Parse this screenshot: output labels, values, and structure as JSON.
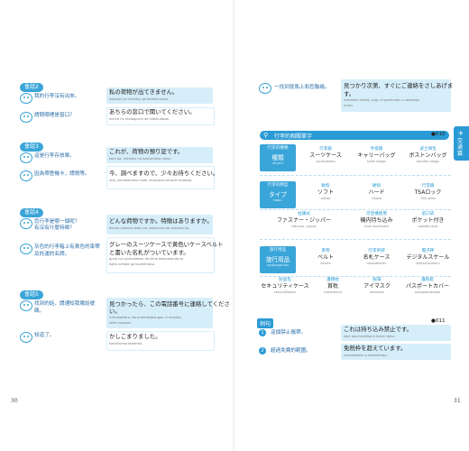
{
  "left": {
    "page_number": "30",
    "dialog2": {
      "label": "會話2",
      "q1": "我的行李沒有出來。",
      "q2": "請問哪裡是窗口？",
      "a1_jp": "私の荷物が出てきません。",
      "a1_rom": "watashi no nimotsu ga detekimasen.",
      "a2_jp": "あちらの窓口で聞いてください。",
      "a2_rom": "achira no madoguchi de kiitekudasai."
    },
    "dialog3": {
      "label": "會話3",
      "q1": "這是行李存放單。",
      "q2": "因為帶登機卡，請稍等。",
      "a1_jp": "これが、荷物の預り証です。",
      "a1_rom": "kore ga, nimotsu no azukarishou desu.",
      "a2_jp": "今、調べますので、少々お待ちください。",
      "a2_rom": "ima, shirabemasu node, shoushou omachi kudasai."
    },
    "dialog4": {
      "label": "會話4",
      "q1": "您行李是哪一個呢？",
      "q1b": "有沒有什麼特徵？",
      "q2": "灰色的行李箱上有黃色的束帶",
      "q2b": "及託運的名牌。",
      "a1_jp": "どんな荷物ですか。特徴はありますか。",
      "a1_rom": "donna nimotsu desu ka. tokuchou wa arimasu ka.",
      "a2_jp": "グレーのスーツケースで黄色いケースベルト",
      "a2_jp2": "と書いた名札がついています。",
      "a2_rom": "gurei no suutsukeesu de kiiroi keesuberuto to",
      "a2_rom2": "kaita nafuda ga tsuiteimasu."
    },
    "dialog5": {
      "label": "會話5",
      "q1": "找到的話，請通知我電話號",
      "q1b": "碼。",
      "q2": "知道了。",
      "a1_jp": "見つかったら、この電話番号に連絡してくださ",
      "a1_jp2": "い。",
      "a1_rom": "mitsukattara, kono denwabangou ni renraku",
      "a1_rom2": "shite kudasai.",
      "a2_jp": "かしこまりました。",
      "a2_rom": "kashikomarimashita."
    }
  },
  "right": {
    "page_number": "31",
    "top": {
      "q": "一找到就馬上和您聯絡。",
      "a_jp": "見つかり次第、すぐにご連絡をさしあげま",
      "a_jp2": "す。",
      "a_rom": "mitsukari shidai, sugu ni gorenraku o sashiage",
      "a_rom2": "masu."
    },
    "vocab_title": "行李的相關單字",
    "track1": "010",
    "row1": {
      "cat_zh": "行李的種類",
      "cat_jp": "種類",
      "cat_rom": "shurui",
      "items": [
        {
          "zh": "行李箱",
          "jp": "スーツケース",
          "rom": "suutsukeesu"
        },
        {
          "zh": "手提箱",
          "jp": "キャリーバッグ",
          "rom": "kyarii baggu"
        },
        {
          "zh": "波士頓包",
          "jp": "ボストンバッグ",
          "rom": "bosuton baggu"
        }
      ]
    },
    "row2": {
      "cat_zh": "行李的類型",
      "cat_jp": "タイプ",
      "cat_rom": "taipu",
      "items": [
        {
          "zh": "軟殼",
          "jp": "ソフト",
          "rom": "sofuto"
        },
        {
          "zh": "硬殼",
          "jp": "ハード",
          "rom": "haado"
        },
        {
          "zh": "行李鎖",
          "jp": "TSAロック",
          "rom": "TSA rokku"
        },
        {
          "zh": "拉鍊式",
          "jp": "ファスナー・ジッパー",
          "rom": "fasunaa・jippaa"
        },
        {
          "zh": "可登機使用",
          "jp": "機内持ち込み",
          "rom": "kinai mochikomi"
        },
        {
          "zh": "前口袋",
          "jp": "ポケット付き",
          "rom": "poketto tsuki"
        }
      ]
    },
    "row3": {
      "cat_zh": "旅行用品",
      "cat_jp": "旅行用品",
      "cat_rom": "ryokouyouhin",
      "items": [
        {
          "zh": "束帶",
          "jp": "ベルト",
          "rom": "beruto"
        },
        {
          "zh": "行李吊牌",
          "jp": "名札ケース",
          "rom": "nafudakeesu"
        },
        {
          "zh": "電子秤",
          "jp": "デジタルスケール",
          "rom": "dejitarusukeeru"
        },
        {
          "zh": "防盜包",
          "jp": "セキュリティケース",
          "rom": "sekyuritikeesu"
        },
        {
          "zh": "護頸枕",
          "jp": "首枕",
          "rom": "kubimakura"
        },
        {
          "zh": "眼罩",
          "jp": "アイマスク",
          "rom": "aimasuku"
        },
        {
          "zh": "護照套",
          "jp": "パスポートカバー",
          "rom": "pasupootokabaa"
        }
      ]
    },
    "example_label": "例句",
    "track2": "011",
    "examples": [
      {
        "num": "1",
        "zh": "這個禁止攜帶。",
        "jp": "これは持ち込み禁止です。",
        "rom": "kore wa mochikomi kinshi desu."
      },
      {
        "num": "2",
        "zh": "超過免費的範圍。",
        "jp": "免税枠を超えています。",
        "rom": "menzeiwaku o koeteimasu."
      }
    ],
    "side_tab": "交通篇"
  }
}
